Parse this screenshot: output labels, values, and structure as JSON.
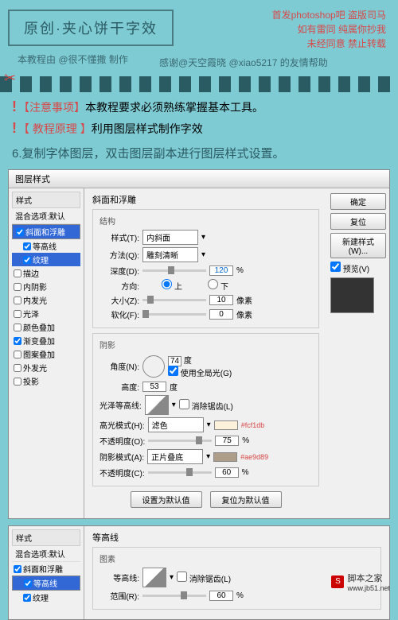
{
  "header": {
    "title": "原创·夹心饼干字效",
    "author": "本教程由 @很不懂撒 制作",
    "thanks": "感谢@天空霞晓 @xiao5217 的友情帮助"
  },
  "warnings": {
    "l1": "首发photoshop吧  盗版司马",
    "l2": "如有雷同  纯属你抄我",
    "l3": "未经同意  禁止转载"
  },
  "notice": {
    "n1_bracket": "【注意事项】",
    "n1_text": "本教程要求必须熟练掌握基本工具。",
    "n2_bracket": "【 教程原理 】",
    "n2_text": "利用图层样式制作字效"
  },
  "step": "6.复制字体图层，双击图层副本进行图层样式设置。",
  "dialog1": {
    "title": "图层样式",
    "left": {
      "head": "样式",
      "sub": "混合选项:默认",
      "items": [
        {
          "label": "斜面和浮雕",
          "checked": true,
          "sel": true
        },
        {
          "label": "等高线",
          "checked": true,
          "indent": true
        },
        {
          "label": "纹理",
          "checked": true,
          "indent": true,
          "sel2": true
        },
        {
          "label": "描边",
          "checked": false
        },
        {
          "label": "内阴影",
          "checked": false
        },
        {
          "label": "内发光",
          "checked": false
        },
        {
          "label": "光泽",
          "checked": false
        },
        {
          "label": "颜色叠加",
          "checked": false
        },
        {
          "label": "渐变叠加",
          "checked": true
        },
        {
          "label": "图案叠加",
          "checked": false
        },
        {
          "label": "外发光",
          "checked": false
        },
        {
          "label": "投影",
          "checked": false
        }
      ]
    },
    "center": {
      "title": "斜面和浮雕",
      "struct": {
        "label": "结构",
        "style_l": "样式(T):",
        "style_v": "内斜面",
        "method_l": "方法(Q):",
        "method_v": "雕刻清晰",
        "depth_l": "深度(D):",
        "depth_v": "120",
        "depth_u": "%",
        "dir_l": "方向:",
        "dir_up": "上",
        "dir_down": "下",
        "size_l": "大小(Z):",
        "size_v": "10",
        "size_u": "像素",
        "soft_l": "软化(F):",
        "soft_v": "0",
        "soft_u": "像素"
      },
      "shade": {
        "label": "阴影",
        "angle_l": "角度(N):",
        "angle_v": "74",
        "angle_u": "度",
        "global_l": "使用全局光(G)",
        "alt_l": "高度:",
        "alt_v": "53",
        "alt_u": "度",
        "gloss_l": "光泽等高线:",
        "anti_l": "消除锯齿(L)",
        "hl_mode_l": "高光模式(H):",
        "hl_mode_v": "滤色",
        "hl_hex": "#fcf1db",
        "hl_op_l": "不透明度(O):",
        "hl_op_v": "75",
        "hl_op_u": "%",
        "sh_mode_l": "阴影模式(A):",
        "sh_mode_v": "正片叠底",
        "sh_hex": "#ae9d89",
        "sh_op_l": "不透明度(C):",
        "sh_op_v": "60",
        "sh_op_u": "%"
      },
      "btns": {
        "def1": "设置为默认值",
        "def2": "复位为默认值"
      }
    },
    "right": {
      "ok": "确定",
      "cancel": "复位",
      "new": "新建样式(W)...",
      "preview": "预览(V)"
    }
  },
  "dialog2": {
    "left": {
      "head": "样式",
      "sub": "混合选项:默认",
      "items": [
        {
          "label": "斜面和浮雕",
          "checked": true
        },
        {
          "label": "等高线",
          "checked": true,
          "indent": true,
          "sel": true
        },
        {
          "label": "纹理",
          "checked": true,
          "indent": true
        }
      ]
    },
    "center": {
      "title": "等高线",
      "group": "图素",
      "contour_l": "等高线:",
      "anti_l": "消除锯齿(L)",
      "range_l": "范围(R):",
      "range_v": "60",
      "range_u": "%"
    }
  },
  "footer": {
    "site": "脚本之家",
    "url": "www.jb51.net"
  }
}
